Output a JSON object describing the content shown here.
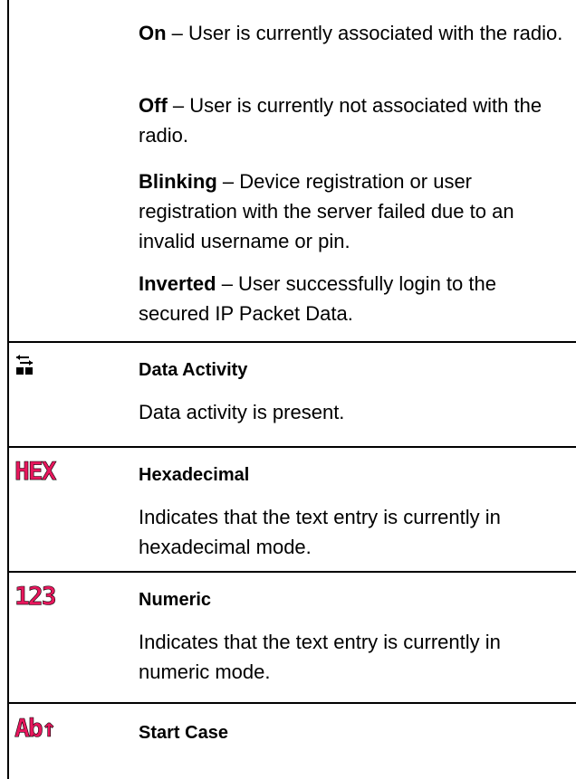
{
  "status_rows": [
    {
      "term": "On",
      "desc": " – User is currently associated with the radio."
    },
    {
      "term": "Off",
      "desc": " – User is currently not associated with the radio."
    },
    {
      "term": "Blinking",
      "desc": " – Device registration or user registration with the server failed due to an invalid username or pin."
    },
    {
      "term": "Inverted",
      "desc": " – User successfully login to the secured IP Packet Data."
    }
  ],
  "entries": [
    {
      "icon": "data-activity-icon",
      "title": "Data Activity",
      "desc": "Data activity is present."
    },
    {
      "icon": "hex-icon",
      "icon_text": "HEX",
      "title": "Hexadecimal",
      "desc": "Indicates that the text entry is currently in hexadecimal mode."
    },
    {
      "icon": "numeric-icon",
      "icon_text": "123",
      "title": "Numeric",
      "desc": "Indicates that the text entry is currently in numeric mode."
    },
    {
      "icon": "start-case-icon",
      "icon_text": "Ab↑",
      "title": "Start Case",
      "desc": ""
    }
  ],
  "colors": {
    "icon_pink": "#e8175d",
    "rule": "#000000"
  }
}
